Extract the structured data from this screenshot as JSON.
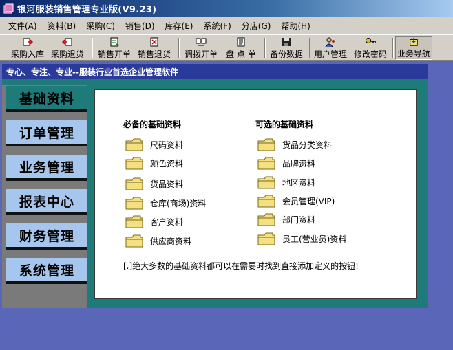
{
  "window": {
    "title": "银河服装销售管理专业版(V9.23)"
  },
  "menu": [
    {
      "label": "文件(A)"
    },
    {
      "label": "资料(B)"
    },
    {
      "label": "采购(C)"
    },
    {
      "label": "销售(D)"
    },
    {
      "label": "库存(E)"
    },
    {
      "label": "系统(F)"
    },
    {
      "label": "分店(G)"
    },
    {
      "label": "帮助(H)"
    }
  ],
  "toolbar": [
    {
      "label": "采购入库",
      "icon": "purchase-in-icon"
    },
    {
      "label": "采购退货",
      "icon": "purchase-return-icon"
    },
    {
      "label": "销售开单",
      "icon": "sales-order-icon"
    },
    {
      "label": "销售退货",
      "icon": "sales-return-icon"
    },
    {
      "label": "调拨开单",
      "icon": "transfer-icon"
    },
    {
      "label": "盘 点 单",
      "icon": "inventory-count-icon"
    },
    {
      "label": "备份数据",
      "icon": "backup-icon"
    },
    {
      "label": "用户管理",
      "icon": "user-management-icon"
    },
    {
      "label": "修改密码",
      "icon": "change-password-icon"
    },
    {
      "label": "业务导航",
      "icon": "business-nav-icon"
    }
  ],
  "banner": "专心、专注、专业--服装行业首选企业管理软件",
  "sidebar": [
    {
      "label": "基础资料",
      "active": true
    },
    {
      "label": "订单管理",
      "active": false
    },
    {
      "label": "业务管理",
      "active": false
    },
    {
      "label": "报表中心",
      "active": false
    },
    {
      "label": "财务管理",
      "active": false
    },
    {
      "label": "系统管理",
      "active": false
    }
  ],
  "content": {
    "required_title": "必备的基础资料",
    "optional_title": "可选的基础资料",
    "required": [
      "尺码资料",
      "颜色资料",
      "货品资料",
      "仓库(商场)资料",
      "客户资料",
      "供应商资料"
    ],
    "optional": [
      "货品分类资料",
      "品牌资料",
      "地区资料",
      "会员管理(VIP)",
      "部门资料",
      "员工(营业员)资料"
    ],
    "note": "[.]绝大多数的基础资料都可以在需要时找到直接添加定义的按钮!"
  },
  "colors": {
    "title_bar": "#0a246a",
    "banner": "#2a3a9a",
    "frame": "#1f7a7a",
    "sidebar_button": "#a6c6ee",
    "desktop": "#5a67b8"
  }
}
